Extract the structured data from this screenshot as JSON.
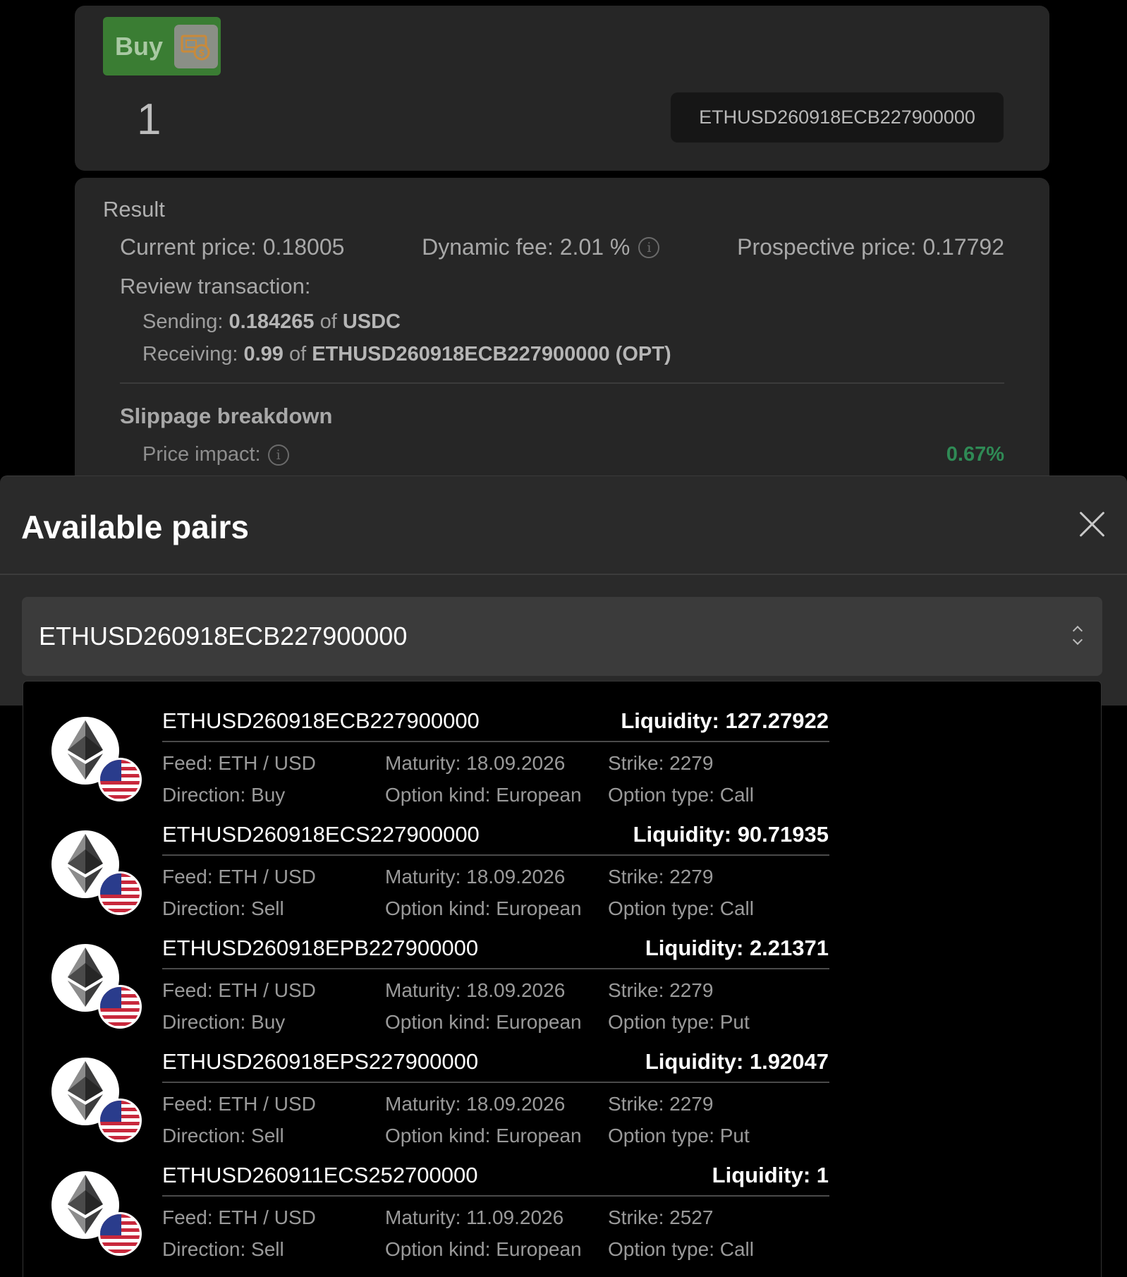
{
  "trade": {
    "buy_label": "Buy",
    "amount": "1",
    "selected_asset": "ETHUSD260918ECB227900000"
  },
  "result": {
    "title": "Result",
    "current_price": "Current price: 0.18005",
    "dynamic_fee": "Dynamic fee: 2.01 %",
    "prospective_price": "Prospective price: 0.17792",
    "review_label": "Review transaction:",
    "sending_prefix": "Sending: ",
    "sending_amount": "0.184265",
    "sending_of": " of ",
    "sending_asset": "USDC",
    "receiving_prefix": "Receiving: ",
    "receiving_amount": "0.99",
    "receiving_of": " of ",
    "receiving_asset": "ETHUSD260918ECB227900000 (OPT)",
    "slippage_title": "Slippage breakdown",
    "price_impact_label": "Price impact:",
    "price_impact_value": "0.67%",
    "price_impact_color": "#2f8a55"
  },
  "modal": {
    "title": "Available pairs",
    "close_icon": "close-icon",
    "search_value": "ETHUSD260918ECB227900000",
    "search_icon": "chevron-up-down-icon"
  },
  "pairs": [
    {
      "name": "ETHUSD260918ECB227900000",
      "liquidity": "Liquidity: 127.27922",
      "feed": "Feed: ETH / USD",
      "maturity": "Maturity: 18.09.2026",
      "strike": "Strike: 2279",
      "direction": "Direction: Buy",
      "kind": "Option kind: European",
      "type": "Option type: Call"
    },
    {
      "name": "ETHUSD260918ECS227900000",
      "liquidity": "Liquidity: 90.71935",
      "feed": "Feed: ETH / USD",
      "maturity": "Maturity: 18.09.2026",
      "strike": "Strike: 2279",
      "direction": "Direction: Sell",
      "kind": "Option kind: European",
      "type": "Option type: Call"
    },
    {
      "name": "ETHUSD260918EPB227900000",
      "liquidity": "Liquidity: 2.21371",
      "feed": "Feed: ETH / USD",
      "maturity": "Maturity: 18.09.2026",
      "strike": "Strike: 2279",
      "direction": "Direction: Buy",
      "kind": "Option kind: European",
      "type": "Option type: Put"
    },
    {
      "name": "ETHUSD260918EPS227900000",
      "liquidity": "Liquidity: 1.92047",
      "feed": "Feed: ETH / USD",
      "maturity": "Maturity: 18.09.2026",
      "strike": "Strike: 2279",
      "direction": "Direction: Sell",
      "kind": "Option kind: European",
      "type": "Option type: Put"
    },
    {
      "name": "ETHUSD260911ECS252700000",
      "liquidity": "Liquidity: 1",
      "feed": "Feed: ETH / USD",
      "maturity": "Maturity: 11.09.2026",
      "strike": "Strike: 2527",
      "direction": "Direction: Sell",
      "kind": "Option kind: European",
      "type": "Option type: Call"
    }
  ],
  "colors": {
    "buy_button": "#3a7d33",
    "modal_background": "#2a2a2a",
    "dropdown_background": "#000000"
  }
}
